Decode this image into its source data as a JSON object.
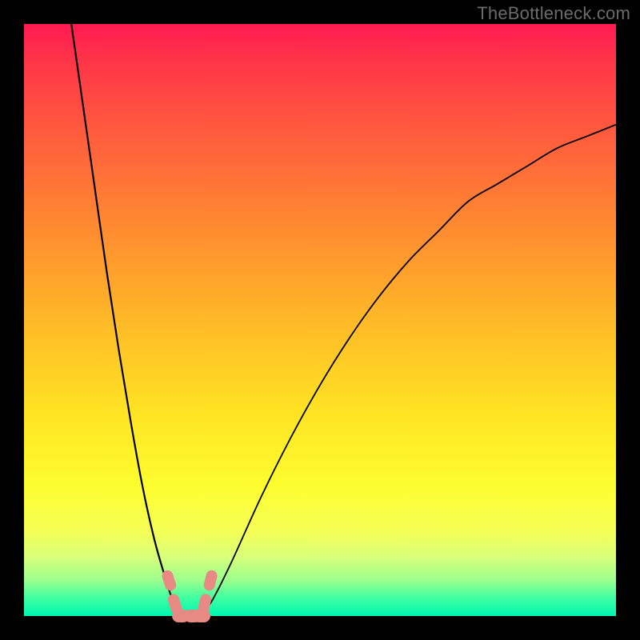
{
  "watermark": "TheBottleneck.com",
  "chart_data": {
    "type": "line",
    "title": "",
    "xlabel": "",
    "ylabel": "",
    "xlim": [
      0,
      100
    ],
    "ylim": [
      0,
      100
    ],
    "grid": false,
    "series": [
      {
        "name": "bottleneck-curve-left",
        "x": [
          8,
          10,
          12,
          14,
          16,
          18,
          20,
          22,
          24,
          25,
          26,
          27
        ],
        "y": [
          100,
          86,
          72,
          58,
          45,
          33,
          22,
          13,
          6,
          3,
          1,
          0
        ]
      },
      {
        "name": "bottleneck-curve-right",
        "x": [
          30,
          32,
          35,
          40,
          45,
          50,
          55,
          60,
          65,
          70,
          75,
          80,
          85,
          90,
          95,
          100
        ],
        "y": [
          0,
          3,
          9,
          20,
          30,
          39,
          47,
          54,
          60,
          65,
          70,
          73,
          76,
          79,
          81,
          83
        ]
      }
    ],
    "markers": [
      {
        "name": "left-marker-top",
        "x": 24.5,
        "y": 6
      },
      {
        "name": "left-marker-bot",
        "x": 25.5,
        "y": 2
      },
      {
        "name": "right-marker-top",
        "x": 31.5,
        "y": 6
      },
      {
        "name": "right-marker-bot",
        "x": 30.5,
        "y": 2
      },
      {
        "name": "base-marker-1",
        "x": 26.5,
        "y": 0
      },
      {
        "name": "base-marker-2",
        "x": 28.5,
        "y": 0
      },
      {
        "name": "base-marker-3",
        "x": 30,
        "y": 0
      }
    ]
  }
}
